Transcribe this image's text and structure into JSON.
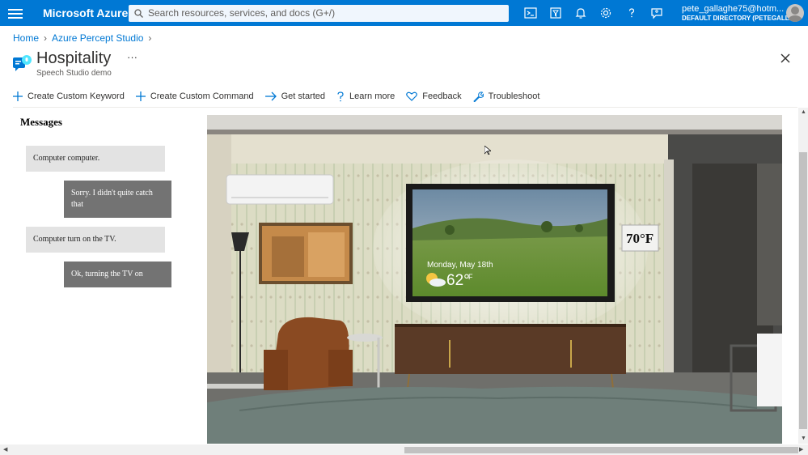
{
  "topbar": {
    "brand": "Microsoft Azure",
    "search_placeholder": "Search resources, services, and docs (G+/)",
    "account_name": "pete_gallaghe75@hotm...",
    "account_directory": "DEFAULT DIRECTORY (PETEGALL..."
  },
  "breadcrumb": {
    "items": [
      "Home",
      "Azure Percept Studio"
    ]
  },
  "resource": {
    "title": "Hospitality",
    "subtitle": "Speech Studio demo",
    "more": "···"
  },
  "commands": [
    {
      "label": "Create Custom Keyword",
      "icon": "plus-icon"
    },
    {
      "label": "Create Custom Command",
      "icon": "plus-icon"
    },
    {
      "label": "Get started",
      "icon": "arrow-right-icon"
    },
    {
      "label": "Learn more",
      "icon": "question-icon"
    },
    {
      "label": "Feedback",
      "icon": "heart-icon"
    },
    {
      "label": "Troubleshoot",
      "icon": "wrench-icon"
    }
  ],
  "messages": {
    "title": "Messages",
    "items": [
      {
        "role": "user",
        "text": "Computer computer."
      },
      {
        "role": "bot",
        "text": "Sorry. I didn't quite catch that"
      },
      {
        "role": "user",
        "text": "Computer turn on the TV."
      },
      {
        "role": "bot",
        "text": "Ok, turning the TV on"
      }
    ]
  },
  "scene": {
    "tv_date": "Monday, May 18th",
    "tv_temp": "62°",
    "tv_temp_unit": "F",
    "thermostat": "70°F"
  },
  "colors": {
    "azure_blue": "#0078d4",
    "user_bubble": "#e3e3e3",
    "bot_bubble": "#737373"
  }
}
